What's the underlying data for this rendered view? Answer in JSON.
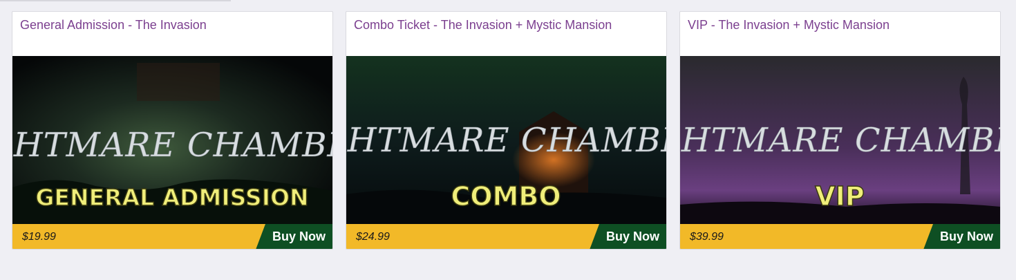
{
  "tickets": [
    {
      "title": "General Admission - The Invasion",
      "image": {
        "logo_text": "NIGHTMARE CHAMBERS",
        "subtitle": "GENERAL ADMISSION",
        "theme": "green-fog"
      },
      "price": "$19.99",
      "buy_label": "Buy Now"
    },
    {
      "title": "Combo Ticket - The Invasion + Mystic Mansion",
      "image": {
        "logo_text": "NIGHTMARE CHAMBERS",
        "subtitle": "COMBO",
        "theme": "haunted-house"
      },
      "price": "$24.99",
      "buy_label": "Buy Now"
    },
    {
      "title": "VIP - The Invasion + Mystic Mansion",
      "image": {
        "logo_text": "NIGHTMARE CHAMBERS",
        "subtitle": "VIP",
        "theme": "purple-mist"
      },
      "price": "$39.99",
      "buy_label": "Buy Now"
    }
  ],
  "colors": {
    "title": "#7b3f8f",
    "price_bar": "#f2b928",
    "buy_button": "#0e4f23",
    "page_bg": "#efeff4",
    "subtitle_text": "#f0ee7a"
  }
}
